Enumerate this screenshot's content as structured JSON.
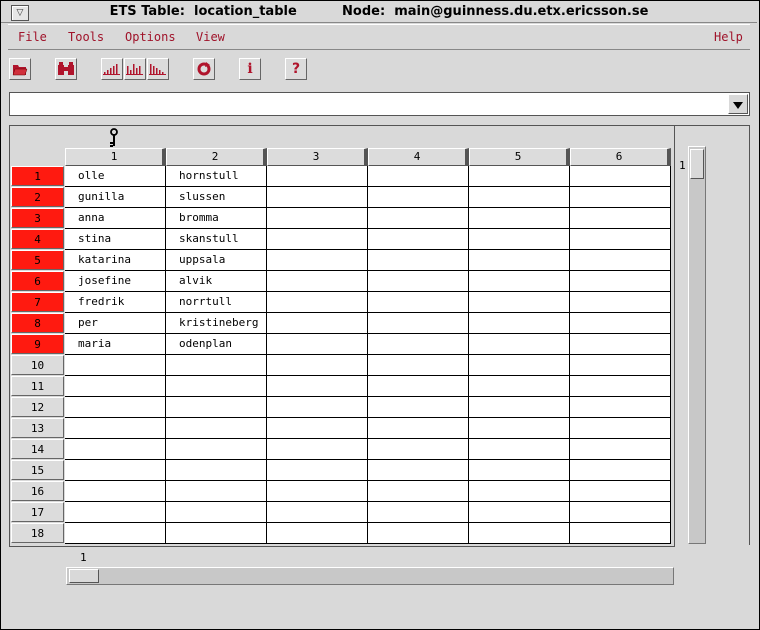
{
  "window": {
    "title": "ETS Table:  location_table          Node:  main@guinness.du.etx.ericsson.se",
    "window_menu_glyph": "▽"
  },
  "menubar": {
    "items": [
      {
        "label": "File",
        "name": "menu-file"
      },
      {
        "label": "Tools",
        "name": "menu-tools"
      },
      {
        "label": "Options",
        "name": "menu-options"
      },
      {
        "label": "View",
        "name": "menu-view"
      },
      {
        "label": "Help",
        "name": "menu-help"
      }
    ]
  },
  "toolbar": {
    "buttons": [
      {
        "icon": "open-folder-icon"
      },
      {
        "icon": "binoculars-icon"
      },
      {
        "icon": "sort-asc-icon"
      },
      {
        "icon": "sort-mixed-icon"
      },
      {
        "icon": "sort-desc-icon"
      },
      {
        "icon": "refresh-icon"
      },
      {
        "icon": "info-icon",
        "glyph": "i"
      },
      {
        "icon": "help-icon",
        "glyph": "?"
      }
    ]
  },
  "search": {
    "value": ""
  },
  "table": {
    "key_column": 1,
    "columns": [
      "1",
      "2",
      "3",
      "4",
      "5",
      "6"
    ],
    "row_numbers": [
      "1",
      "2",
      "3",
      "4",
      "5",
      "6",
      "7",
      "8",
      "9",
      "10",
      "11",
      "12",
      "13",
      "14",
      "15",
      "16",
      "17",
      "18"
    ],
    "rows": [
      [
        "olle",
        "hornstull"
      ],
      [
        "gunilla",
        "slussen"
      ],
      [
        "anna",
        "bromma"
      ],
      [
        "stina",
        "skanstull"
      ],
      [
        "katarina",
        "uppsala"
      ],
      [
        "josefine",
        "alvik"
      ],
      [
        "fredrik",
        "norrtull"
      ],
      [
        "per",
        "kristineberg"
      ],
      [
        "maria",
        "odenplan"
      ]
    ],
    "filled_row_color": "#ff1a10",
    "empty_row_color": "#dcdcdc"
  },
  "scroll": {
    "vertical_position": "1",
    "horizontal_position": "1"
  },
  "colors": {
    "menu_text": "#a0132a",
    "background": "#d9d9d9"
  }
}
